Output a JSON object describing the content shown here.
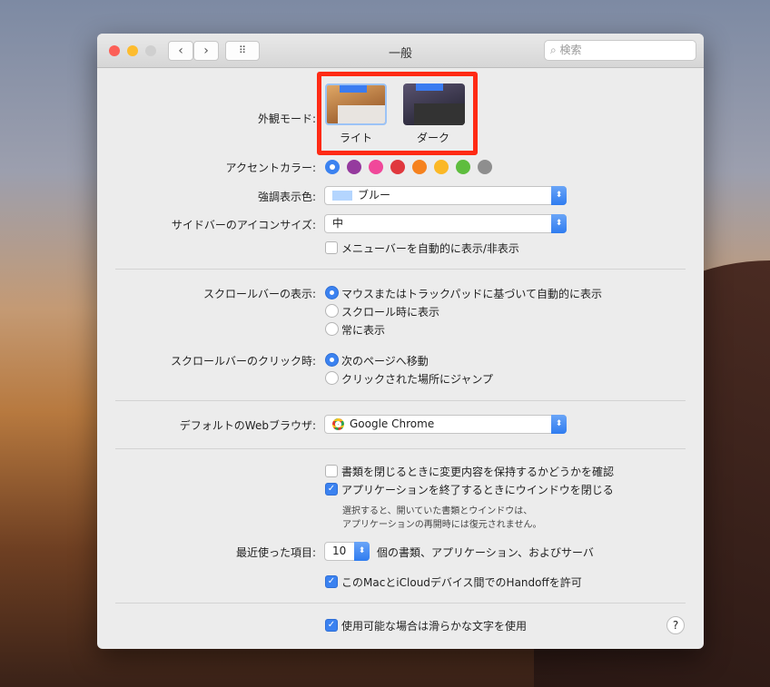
{
  "window": {
    "title": "一般",
    "search_placeholder": "検索",
    "grid_icon": "grid-icon"
  },
  "appearance": {
    "label": "外観モード:",
    "options": [
      {
        "label": "ライト",
        "selected": true
      },
      {
        "label": "ダーク",
        "selected": false
      }
    ],
    "highlight_color": "#ff2a14"
  },
  "accent": {
    "label": "アクセントカラー:",
    "colors": [
      "#3b82f0",
      "#953a9e",
      "#f0489a",
      "#e0383e",
      "#f5821f",
      "#fbb826",
      "#5ebd3e",
      "#8e8e8e"
    ],
    "selected_index": 0
  },
  "highlight": {
    "label": "強調表示色:",
    "value": "ブルー",
    "swatch": "#b4d5fe"
  },
  "sidebar_icon_size": {
    "label": "サイドバーのアイコンサイズ:",
    "value": "中"
  },
  "menubar": {
    "label": "メニューバーを自動的に表示/非表示",
    "checked": false
  },
  "scrollbar_show": {
    "label": "スクロールバーの表示:",
    "options": [
      "マウスまたはトラックパッドに基づいて自動的に表示",
      "スクロール時に表示",
      "常に表示"
    ],
    "selected_index": 0
  },
  "scrollbar_click": {
    "label": "スクロールバーのクリック時:",
    "options": [
      "次のページへ移動",
      "クリックされた場所にジャンプ"
    ],
    "selected_index": 0
  },
  "browser": {
    "label": "デフォルトのWebブラウザ:",
    "value": "Google Chrome"
  },
  "close_confirm": {
    "label": "書類を閉じるときに変更内容を保持するかどうかを確認",
    "checked": false
  },
  "close_windows": {
    "label": "アプリケーションを終了するときにウインドウを閉じる",
    "checked": true,
    "note1": "選択すると、開いていた書類とウインドウは、",
    "note2": "アプリケーションの再開時には復元されません。"
  },
  "recent": {
    "label": "最近使った項目:",
    "value": "10",
    "suffix": "個の書類、アプリケーション、およびサーバ"
  },
  "handoff": {
    "label": "このMacとiCloudデバイス間でのHandoffを許可",
    "checked": true
  },
  "smooth": {
    "label": "使用可能な場合は滑らかな文字を使用",
    "checked": true
  },
  "help": "?"
}
